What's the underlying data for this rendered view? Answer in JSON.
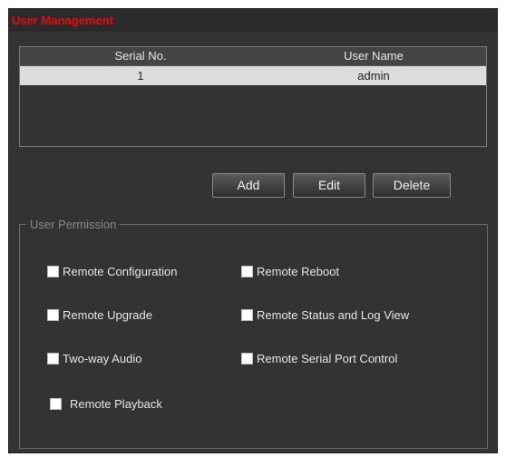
{
  "panel": {
    "title": "User Management"
  },
  "table": {
    "headers": [
      "Serial No.",
      "User Name"
    ],
    "rows": [
      {
        "serial": "1",
        "username": "admin"
      }
    ]
  },
  "buttons": {
    "add": "Add",
    "edit": "Edit",
    "delete": "Delete"
  },
  "permissions": {
    "legend": "User Permission",
    "items": [
      "Remote Configuration",
      "Remote Reboot",
      "Remote Upgrade",
      "Remote Status and Log View",
      "Two-way Audio",
      "Remote Serial Port Control",
      "Remote Playback"
    ]
  },
  "colors": {
    "title": "#e01010",
    "panel": "#333333",
    "selected_row": "#dcdcdc"
  }
}
